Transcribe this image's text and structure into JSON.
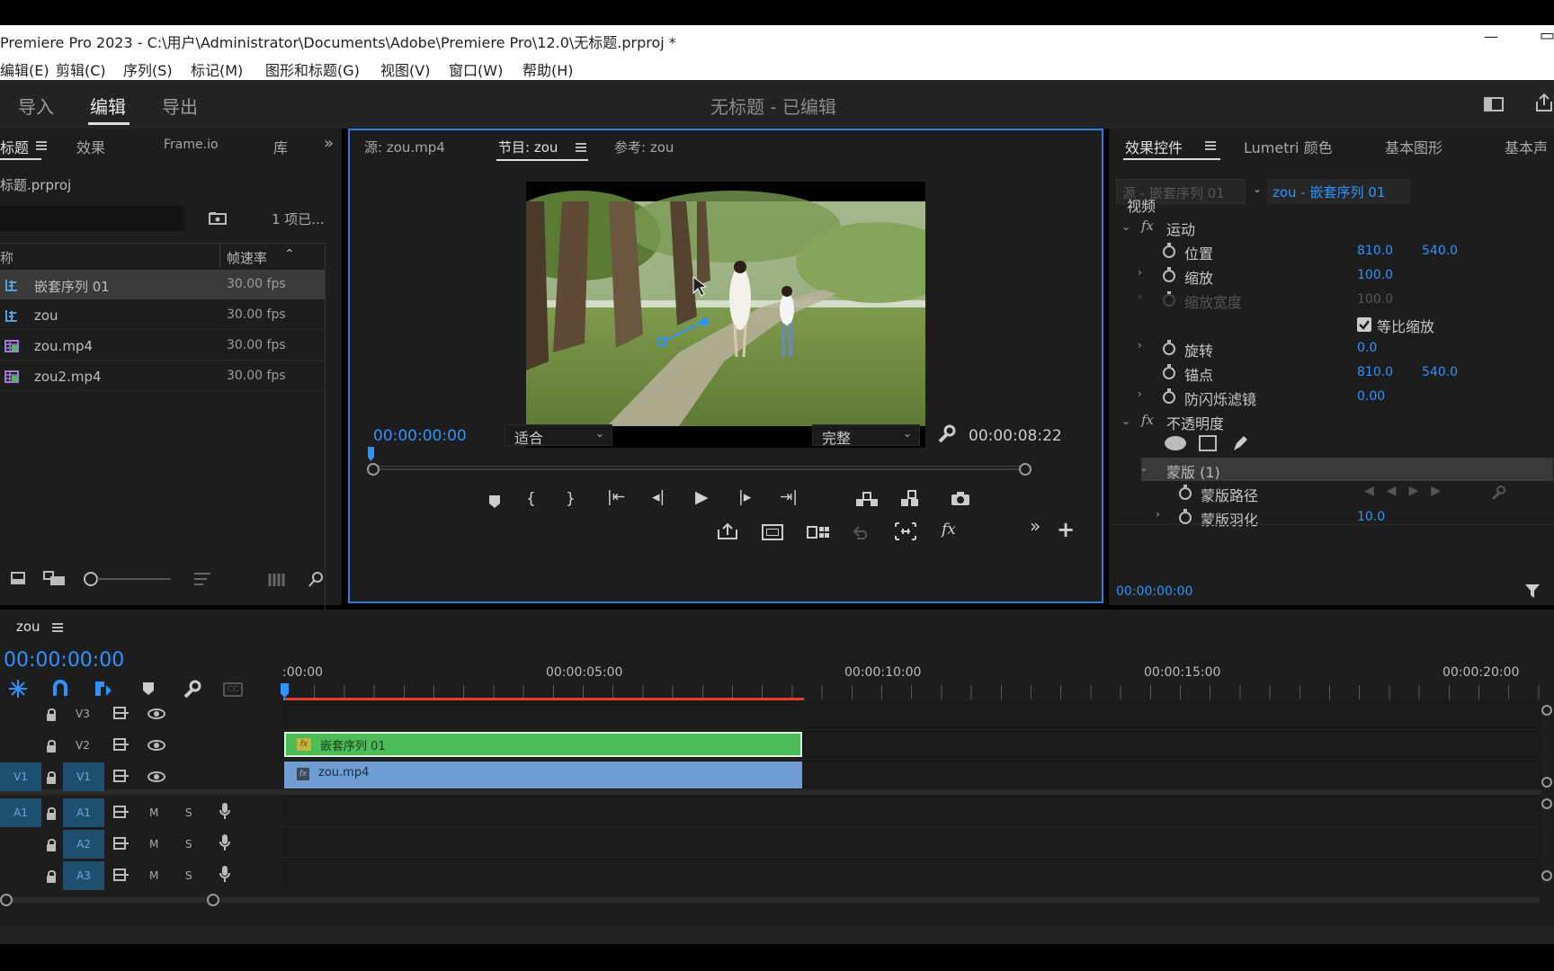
{
  "window": {
    "title": "Premiere Pro 2023 - C:\\用户\\Administrator\\Documents\\Adobe\\Premiere Pro\\12.0\\无标题.prproj *",
    "minimize": "—",
    "restore": "▭"
  },
  "menu": [
    "编辑(E)",
    "剪辑(C)",
    "序列(S)",
    "标记(M)",
    "图形和标题(G)",
    "视图(V)",
    "窗口(W)",
    "帮助(H)"
  ],
  "workspace": {
    "tabs": [
      "导入",
      "编辑",
      "导出"
    ],
    "active": "编辑",
    "doc_title": "无标题 - 已编辑"
  },
  "project_panel": {
    "tabs": [
      "标题",
      "效果",
      "Frame.io",
      "库"
    ],
    "project_name": "标题.prproj",
    "item_count": "1 项已...",
    "col_name": "称",
    "col_fps": "帧速率",
    "items": [
      {
        "name": "嵌套序列 01",
        "fps": "30.00 fps",
        "type": "sequence"
      },
      {
        "name": "zou",
        "fps": "30.00 fps",
        "type": "sequence"
      },
      {
        "name": "zou.mp4",
        "fps": "30.00 fps",
        "type": "clip"
      },
      {
        "name": "zou2.mp4",
        "fps": "30.00 fps",
        "type": "clip"
      }
    ]
  },
  "monitor": {
    "tabs": [
      "源: zou.mp4",
      "节目: zou",
      "参考: zou"
    ],
    "active_tab": "节目: zou",
    "timecode": "00:00:00:00",
    "fit": "适合",
    "quality": "完整",
    "duration": "00:00:08:22"
  },
  "effects": {
    "tabs": [
      "效果控件",
      "Lumetri 颜色",
      "基本图形",
      "基本声"
    ],
    "source_label": "源 - 嵌套序列 01",
    "target_label": "zou - 嵌套序列 01",
    "section_video": "视频",
    "motion": "运动",
    "position": "位置",
    "position_x": "810.0",
    "position_y": "540.0",
    "scale": "缩放",
    "scale_val": "100.0",
    "scale_width": "缩放宽度",
    "scale_width_val": "100.0",
    "uniform_scale": "等比缩放",
    "rotation": "旋转",
    "rotation_val": "0.0",
    "anchor": "锚点",
    "anchor_x": "810.0",
    "anchor_y": "540.0",
    "antiflicker": "防闪烁滤镜",
    "antiflicker_val": "0.00",
    "opacity": "不透明度",
    "mask": "蒙版 (1)",
    "mask_path": "蒙版路径",
    "mask_feather": "蒙版羽化",
    "mask_feather_val": "10.0",
    "timecode": "00:00:00:00"
  },
  "timeline": {
    "seq_name": "zou",
    "timecode": "00:00:00:00",
    "ruler": [
      ":00:00",
      "00:00:05:00",
      "00:00:10:00",
      "00:00:15:00",
      "00:00:20:00"
    ],
    "tracks": {
      "v3": "V3",
      "v2": "V2",
      "v1": "V1",
      "a1": "A1",
      "a2": "A2",
      "a3": "A3",
      "src_v1": "V1",
      "src_a1": "A1",
      "m": "M",
      "s": "S"
    },
    "clips": {
      "v2": "嵌套序列 01",
      "v1": "zou.mp4"
    }
  },
  "colors": {
    "accent": "#2e93ff",
    "clip_green": "#4cbc57",
    "clip_blue": "#6f9cd3",
    "work_area": "#e23b2a"
  }
}
